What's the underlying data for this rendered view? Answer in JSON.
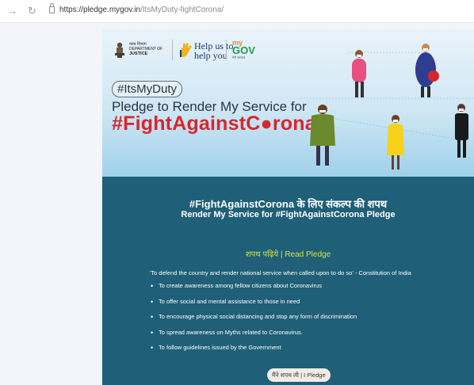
{
  "browser": {
    "url_domain": "https://pledge.mygov.in",
    "url_path": "/ItsMyDuty-fightCorona/",
    "back_icon": "arrow-left-icon",
    "reload_icon": "reload-icon",
    "lock_icon": "lock-icon"
  },
  "banner": {
    "doj_hindi": "न्याय विभाग",
    "doj_line1": "DEPARTMENT OF",
    "doj_line2": "JUSTICE",
    "helpus_line1": "Help us to",
    "helpus_line2": "help you",
    "mygov_top": "my",
    "mygov_bottom": "GOV",
    "mygov_hindi": "मेरी सरकार",
    "hashtag": "#ItsMyDuty",
    "title_line": "Pledge to Render My Service for",
    "fight_title": "#FightAgainstC●rona",
    "colors": {
      "fight_red": "#d8262e",
      "teal": "#1f5f77",
      "read_pledge": "#cfe64a"
    }
  },
  "main": {
    "heading_hindi": "#FightAgainstCorona के लिए संकल्प की शपथ",
    "heading_english": "Render My Service for #FightAgainstCorona Pledge",
    "read_pledge": "शपथ पढ़िये | Read Pledge",
    "quote": "'To defend the country and render national service when called upon to do so' - Constitution of India",
    "bullets": [
      "To create awareness among fellow citizens about Coronavirus",
      "To offer social and mental assistance to those in need",
      "To encourage physical social distancing and stop any form of discrimination",
      "To spread awareness on Myths related to Coronavirus.",
      "To follow guidelines issued by the Government"
    ],
    "pledge_button": "मैंने शपथ ली | I Pledge"
  }
}
